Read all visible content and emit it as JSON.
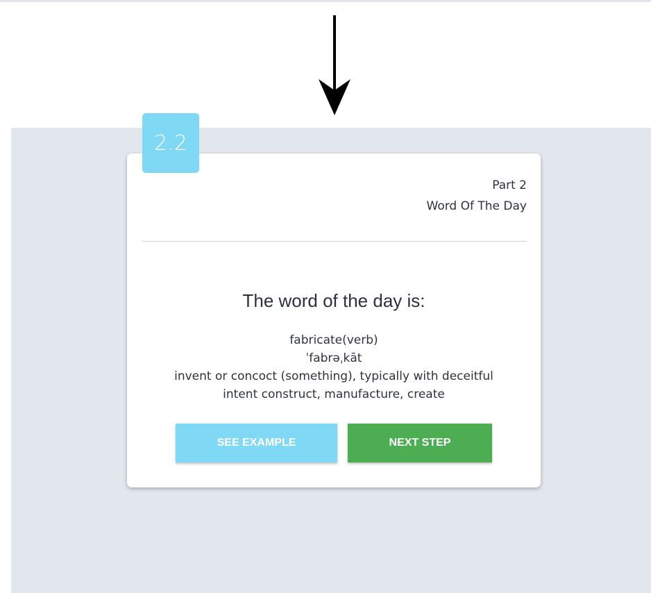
{
  "badge": {
    "label": "2.2"
  },
  "card": {
    "part_label": "Part 2",
    "section_title": "Word Of The Day",
    "heading": "The word of the day is:",
    "word_line": "fabricate(verb)",
    "pronunciation": "ˈfabrəˌkāt",
    "definition_line1": "invent or concoct (something), typically with deceitful",
    "definition_line2": "intent construct, manufacture, create"
  },
  "buttons": {
    "see_example": "SEE EXAMPLE",
    "next_step": "NEXT STEP"
  },
  "icons": {
    "pointer": "arrow-down-icon"
  },
  "colors": {
    "accent_blue": "#7fd8f4",
    "accent_green": "#4cad53",
    "panel_background": "#e2e7ee"
  }
}
